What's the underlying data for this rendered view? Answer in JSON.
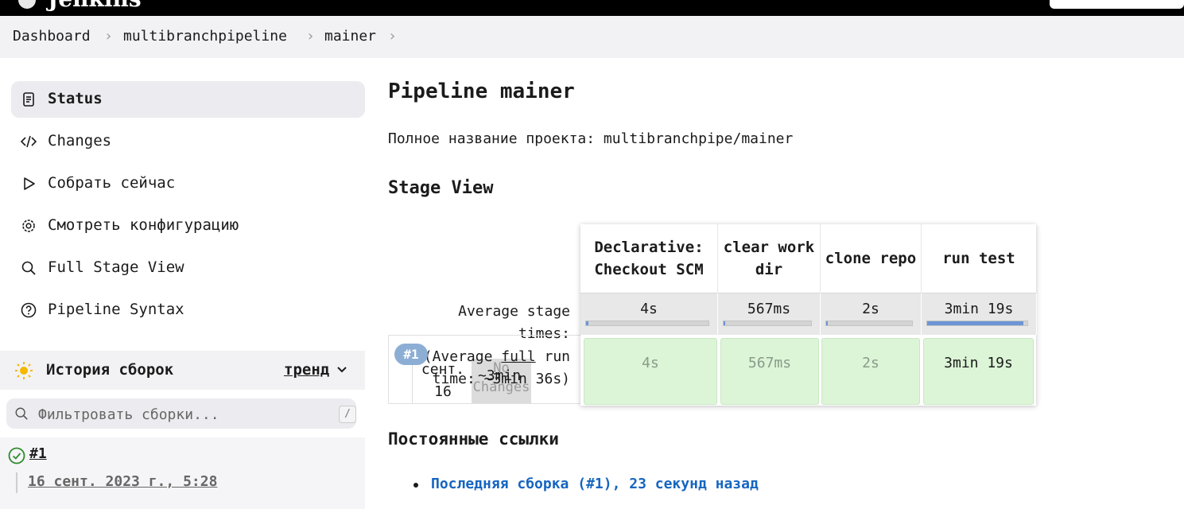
{
  "header": {
    "brand": "Jenkins"
  },
  "breadcrumbs": [
    "Dashboard",
    "multibranchpipeline",
    "mainer"
  ],
  "sidebar": {
    "items": [
      {
        "label": "Status",
        "icon": "notepad-icon",
        "active": true
      },
      {
        "label": "Changes",
        "icon": "code-icon"
      },
      {
        "label": "Собрать сейчас",
        "icon": "play-icon"
      },
      {
        "label": "Смотреть конфигурацию",
        "icon": "gear-icon"
      },
      {
        "label": "Full Stage View",
        "icon": "search-icon"
      },
      {
        "label": "Pipeline Syntax",
        "icon": "help-icon"
      }
    ]
  },
  "history": {
    "title": "История сборок",
    "trend": "тренд",
    "filter_placeholder": "Фильтровать сборки...",
    "filter_shortcut": "/",
    "builds": [
      {
        "number": "#1",
        "date": "16 сент. 2023 г., 5:28",
        "status": "success"
      }
    ]
  },
  "main": {
    "title": "Pipeline mainer",
    "full_name": "Полное название проекта: multibranchpipe/mainer",
    "stage_view_title": "Stage View",
    "avg_stage_times": "Average stage times:",
    "avg_full_run_prefix": "(Average ",
    "avg_full_run_underlined": "full",
    "avg_full_run_suffix": " run time: ~3min 36s)",
    "stages": [
      {
        "name": "Declarative: Checkout SCM",
        "avg": "4s",
        "cell": "4s",
        "fraction": 0.02
      },
      {
        "name": "clear work dir",
        "avg": "567ms",
        "cell": "567ms",
        "fraction": 0.003
      },
      {
        "name": "clone repo",
        "avg": "2s",
        "cell": "2s",
        "fraction": 0.01
      },
      {
        "name": "run test",
        "avg": "3min 19s",
        "cell": "3min 19s",
        "fraction": 0.96
      }
    ],
    "run": {
      "badge": "#1",
      "date": "сент. 16",
      "changes": "No Changes",
      "duration": "~3min"
    },
    "permalinks_title": "Постоянные ссылки",
    "permalinks": [
      "Последняя сборка (#1), 23 секунд назад"
    ]
  },
  "colors": {
    "accent": "#1565c0",
    "success": "#2e8b2e",
    "badge": "#8caed5",
    "stage_success": "#dcf5d7"
  }
}
